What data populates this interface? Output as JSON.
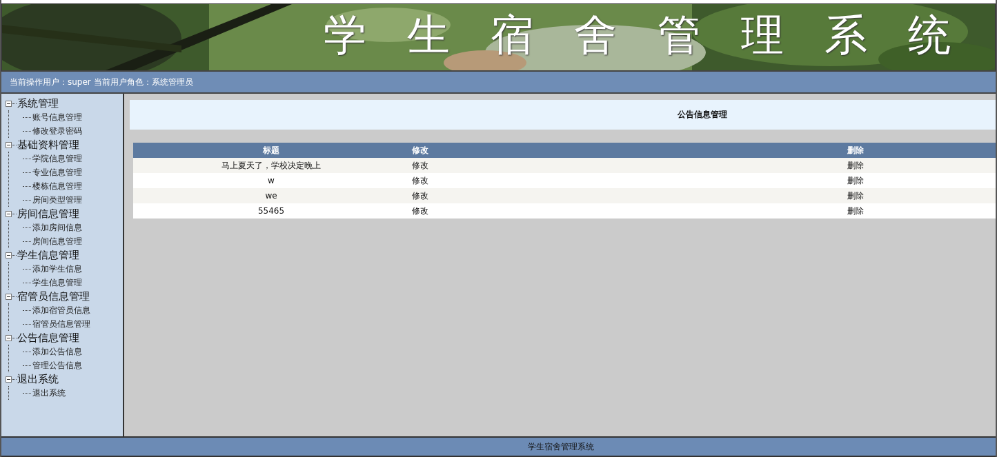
{
  "banner": {
    "title": "学生宿舍管理系统"
  },
  "user_bar": {
    "text": "当前操作用户：super 当前用户角色：系统管理员"
  },
  "sidebar": {
    "items": [
      {
        "label": "系统管理",
        "expanded": true,
        "children": [
          {
            "label": "账号信息管理"
          },
          {
            "label": "修改登录密码"
          }
        ]
      },
      {
        "label": "基础资料管理",
        "expanded": true,
        "children": [
          {
            "label": "学院信息管理"
          },
          {
            "label": "专业信息管理"
          },
          {
            "label": "楼栋信息管理"
          },
          {
            "label": "房间类型管理"
          }
        ]
      },
      {
        "label": "房间信息管理",
        "expanded": true,
        "children": [
          {
            "label": "添加房间信息"
          },
          {
            "label": "房间信息管理"
          }
        ]
      },
      {
        "label": "学生信息管理",
        "expanded": true,
        "children": [
          {
            "label": "添加学生信息"
          },
          {
            "label": "学生信息管理"
          }
        ]
      },
      {
        "label": "宿管员信息管理",
        "expanded": true,
        "children": [
          {
            "label": "添加宿管员信息"
          },
          {
            "label": "宿管员信息管理"
          }
        ]
      },
      {
        "label": "公告信息管理",
        "expanded": true,
        "children": [
          {
            "label": "添加公告信息"
          },
          {
            "label": "管理公告信息"
          }
        ]
      },
      {
        "label": "退出系统",
        "expanded": true,
        "children": [
          {
            "label": "退出系统"
          }
        ]
      }
    ]
  },
  "page_title": "公告信息管理",
  "table": {
    "columns": [
      "标题",
      "修改",
      "删除"
    ],
    "rows": [
      {
        "title": "马上夏天了，学校决定晚上",
        "edit": "修改",
        "delete": "删除"
      },
      {
        "title": "w",
        "edit": "修改",
        "delete": "删除"
      },
      {
        "title": "we",
        "edit": "修改",
        "delete": "删除"
      },
      {
        "title": "55465",
        "edit": "修改",
        "delete": "删除"
      }
    ]
  },
  "footer": {
    "text": "学生宿舍管理系统"
  }
}
